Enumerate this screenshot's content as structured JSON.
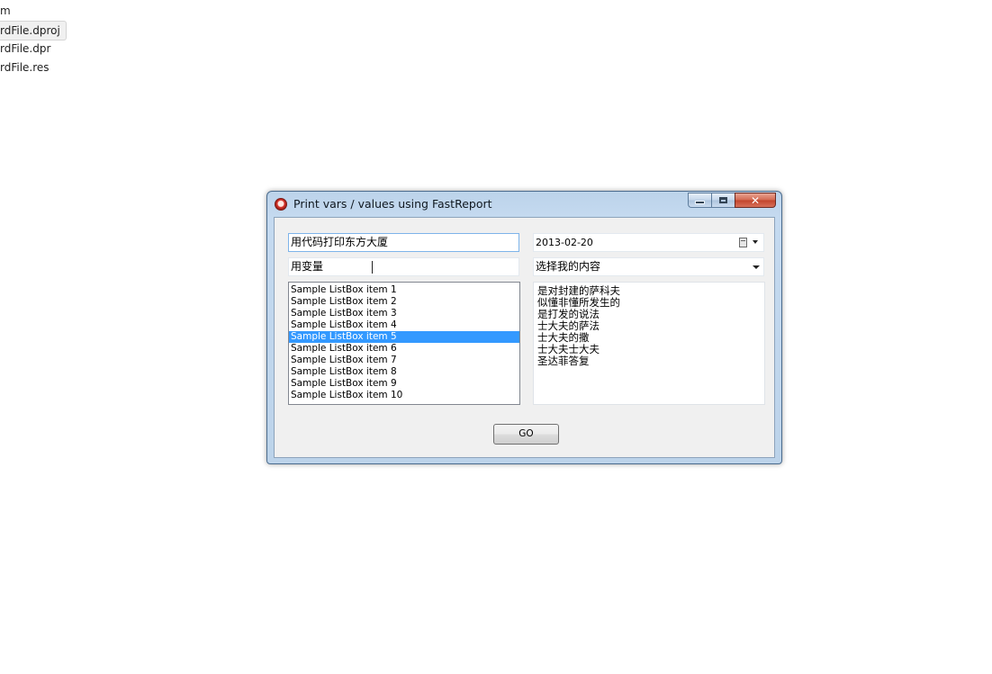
{
  "background_files": [
    "m",
    "rdFile.dproj",
    "rdFile.dpr",
    "rdFile.res"
  ],
  "window": {
    "title": "Print vars / values using FastReport",
    "buttons": {
      "minimize": "",
      "maximize": "",
      "close": "✕"
    }
  },
  "form": {
    "text_edit_1": "用代码打印东方大厦",
    "text_edit_2": "用变量",
    "date_value": "2013-02-20",
    "combo_value": "选择我的内容",
    "listbox_items": [
      "Sample ListBox item 1",
      "Sample ListBox item 2",
      "Sample ListBox item 3",
      "Sample ListBox item 4",
      "Sample ListBox item 5",
      "Sample ListBox item 6",
      "Sample ListBox item 7",
      "Sample ListBox item 8",
      "Sample ListBox item 9",
      "Sample ListBox item 10"
    ],
    "listbox_selected": "Sample ListBox item 5",
    "memo_lines": [
      "是对封建的萨科夫",
      "似懂非懂所发生的",
      "是打发的说法",
      "士大夫的萨法",
      "士大夫的撒",
      "士大夫士大夫",
      "圣达菲答复"
    ],
    "go_label": "GO"
  },
  "colors": {
    "selection": "#3399ff",
    "window_frame": "#bcd3ea",
    "close_button": "#c2442b"
  }
}
